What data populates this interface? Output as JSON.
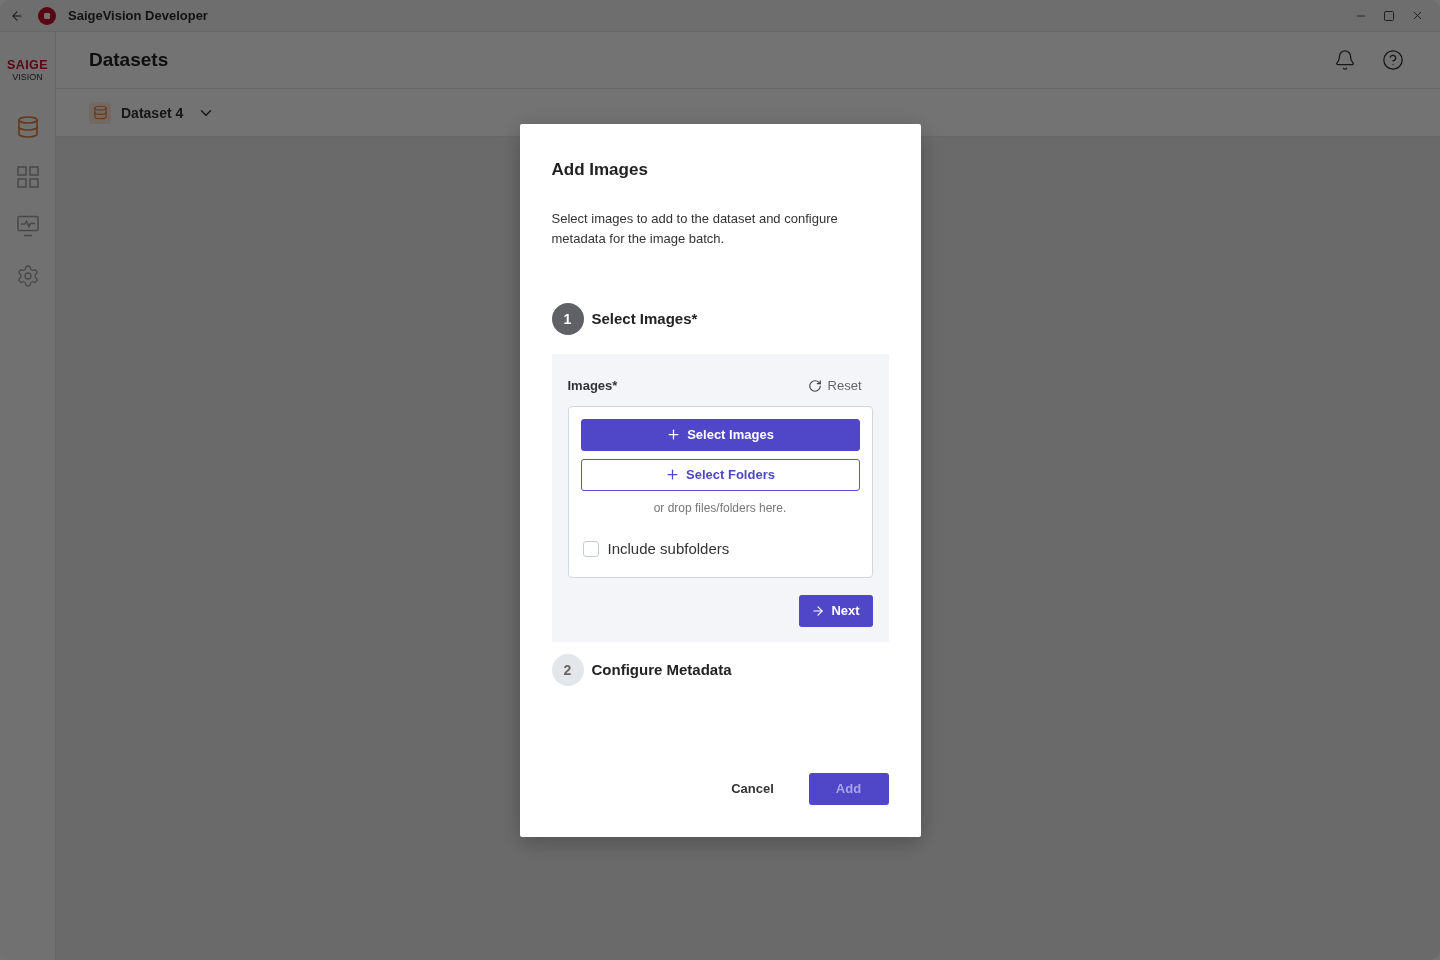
{
  "window": {
    "title": "SaigeVision Developer"
  },
  "sidebar": {
    "logo": {
      "wordmark": "SAIGE",
      "subtitle": "VISION"
    },
    "items": [
      {
        "selected": true
      },
      {
        "selected": false
      },
      {
        "selected": false
      },
      {
        "selected": false
      }
    ]
  },
  "header": {
    "title": "Datasets"
  },
  "dataset_selector": {
    "name": "Dataset 4"
  },
  "dialog": {
    "title": "Add Images",
    "description": "Select images to add to the dataset and configure metadata for the image batch.",
    "steps": [
      {
        "number": "1",
        "title": "Select Images*",
        "active": true,
        "panel": {
          "field_label": "Images*",
          "reset_label": "Reset",
          "buttons": [
            {
              "label": "Select Images",
              "kind": "primary"
            },
            {
              "label": "Select Folders",
              "kind": "outline"
            }
          ],
          "drop_hint": "or drop files/folders here.",
          "include_subfolders": {
            "label": "Include subfolders",
            "checked": false
          },
          "next_label": "Next"
        }
      },
      {
        "number": "2",
        "title": "Configure Metadata",
        "active": false
      }
    ],
    "footer": {
      "cancel_label": "Cancel",
      "add": {
        "label": "Add",
        "disabled": true
      }
    }
  }
}
